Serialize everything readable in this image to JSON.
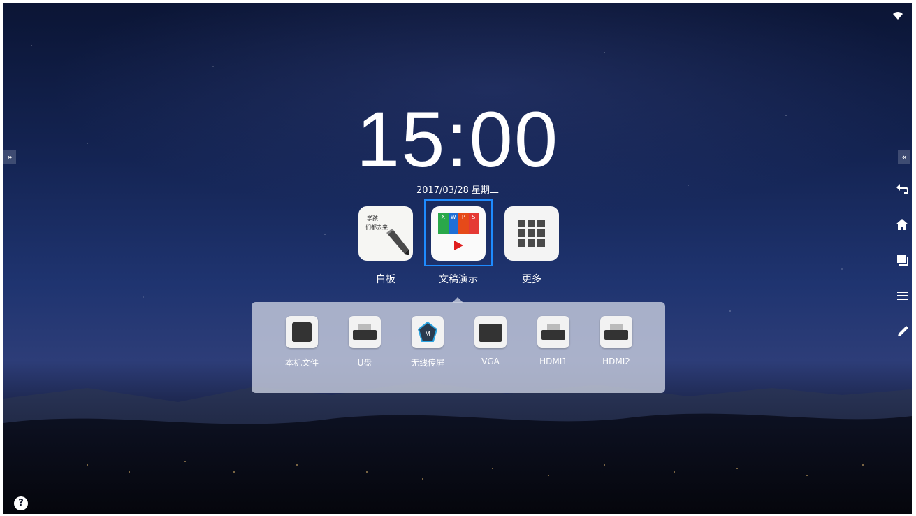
{
  "status": {
    "wifi_icon": "wifi-icon"
  },
  "clock": {
    "time": "15:00",
    "date": "2017/03/28 星期二"
  },
  "apps": [
    {
      "label": "白板",
      "icon": "whiteboard-icon"
    },
    {
      "label": "文稿演示",
      "icon": "presentation-icon",
      "focused": true
    },
    {
      "label": "更多",
      "icon": "grid-icon"
    }
  ],
  "sources": [
    {
      "label": "本机文件",
      "icon": "local-files-icon"
    },
    {
      "label": "U盘",
      "icon": "usb-drive-icon"
    },
    {
      "label": "无线传屏",
      "icon": "wireless-cast-icon"
    },
    {
      "label": "VGA",
      "icon": "vga-icon"
    },
    {
      "label": "HDMI1",
      "icon": "hdmi-icon"
    },
    {
      "label": "HDMI2",
      "icon": "hdmi-icon"
    }
  ],
  "whiteboard_tile": {
    "line1": "学孩",
    "line2": "们都去来"
  },
  "presentation_tile": {
    "letters": [
      "X",
      "W",
      "P",
      "S"
    ]
  },
  "left_rail": {
    "expand": "»"
  },
  "right_rail": {
    "collapse": "«",
    "buttons": [
      "back-icon",
      "home-icon",
      "windows-icon",
      "menu-icon",
      "pen-icon"
    ]
  },
  "help": {
    "label": "?"
  },
  "colors": {
    "focus": "#1e8bff",
    "panel": "#cdd2e1",
    "play": "#e01e1e"
  }
}
